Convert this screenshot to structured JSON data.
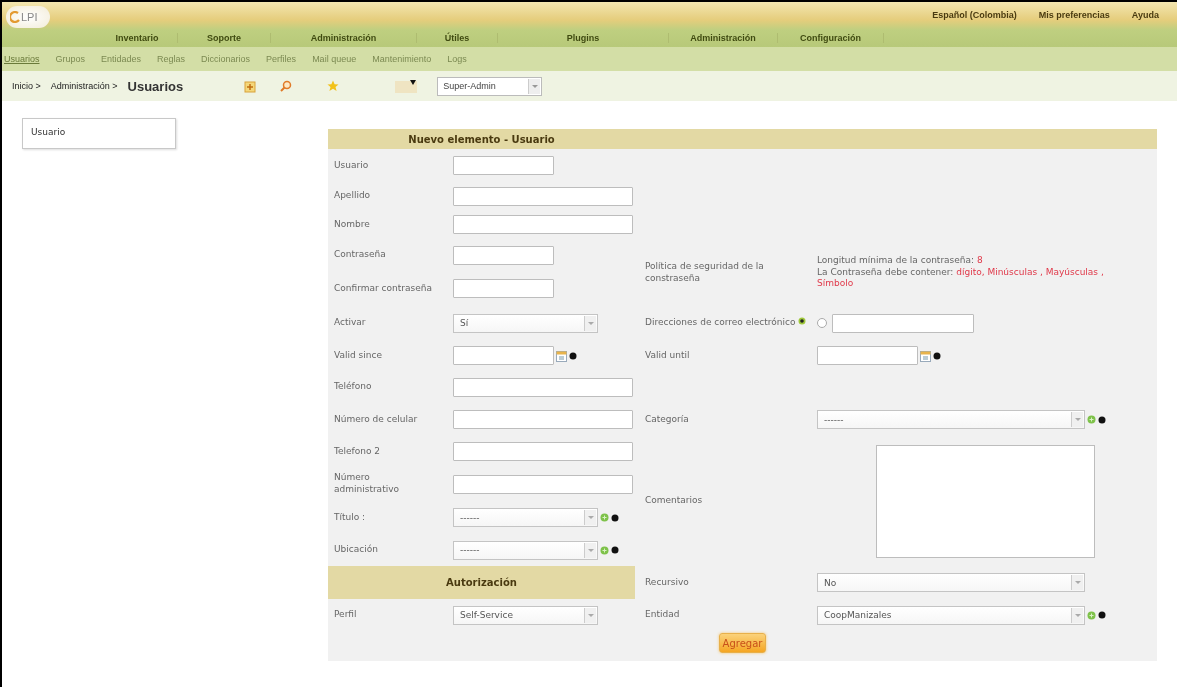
{
  "header": {
    "logo_text": "LPI",
    "top_links": [
      "Español (Colombia)",
      "Mis preferencias",
      "Ayuda"
    ],
    "menu": [
      "Inventario",
      "Soporte",
      "Administración",
      "Útiles",
      "Plugins",
      "Administración",
      "Configuración"
    ]
  },
  "submenu": [
    {
      "label": "Usuarios",
      "selected": true
    },
    {
      "label": "Grupos",
      "selected": false
    },
    {
      "label": "Entidades",
      "selected": false
    },
    {
      "label": "Reglas",
      "selected": false
    },
    {
      "label": "Diccionarios",
      "selected": false
    },
    {
      "label": "Perfiles",
      "selected": false
    },
    {
      "label": "Mail queue",
      "selected": false
    },
    {
      "label": "Mantenimiento",
      "selected": false
    },
    {
      "label": "Logs",
      "selected": false
    }
  ],
  "breadcrumb": {
    "items": [
      "Inicio >",
      "Administración >"
    ],
    "current": "Usuarios",
    "profile": "Super-Admin"
  },
  "sidebar": {
    "items": [
      "Usuario"
    ]
  },
  "form": {
    "title": "Nuevo elemento - Usuario",
    "left_fields": [
      {
        "kind": "short_text",
        "label": "Usuario"
      },
      {
        "kind": "text",
        "label": "Apellido"
      },
      {
        "kind": "text",
        "label": "Nombre"
      },
      {
        "kind": "short_text",
        "label": "Contraseña"
      },
      {
        "kind": "short_text",
        "label": "Confirmar contraseña"
      },
      {
        "kind": "select",
        "label": "Activar",
        "value": "Sí"
      },
      {
        "kind": "date",
        "label": "Valid since"
      },
      {
        "kind": "text",
        "label": "Teléfono"
      },
      {
        "kind": "text",
        "label": "Número de celular"
      },
      {
        "kind": "text",
        "label": "Telefono 2"
      },
      {
        "kind": "text",
        "label": "Número administrativo"
      },
      {
        "kind": "select_add",
        "label": "Título :",
        "value": "------"
      },
      {
        "kind": "select_add",
        "label": "Ubicación",
        "value": "------"
      },
      {
        "kind": "section",
        "label": "Autorización"
      },
      {
        "kind": "select",
        "label": "Perfil",
        "value": "Self-Service"
      }
    ],
    "right_fields": [
      {
        "kind": "policy",
        "label": "Política de seguridad de la constraseña",
        "min_length_label": "Longitud mínima de la contraseña:",
        "min_length": "8",
        "requirements_label": "La Contraseña debe contener:",
        "requirements": "dígito, Minúsculas , Mayúsculas , Símbolo"
      },
      {
        "kind": "email",
        "label": "Direcciones de correo electrónico",
        "checked": false
      },
      {
        "kind": "date",
        "label": "Valid until"
      },
      {
        "kind": "wide_select_add",
        "label": "Categoría",
        "value": "------"
      },
      {
        "kind": "textarea",
        "label": "Comentarios"
      },
      {
        "kind": "wide_select",
        "label": "Recursivo",
        "value": "No"
      },
      {
        "kind": "wide_select_add",
        "label": "Entidad",
        "value": "CoopManizales"
      }
    ],
    "submit": "Agregar"
  }
}
